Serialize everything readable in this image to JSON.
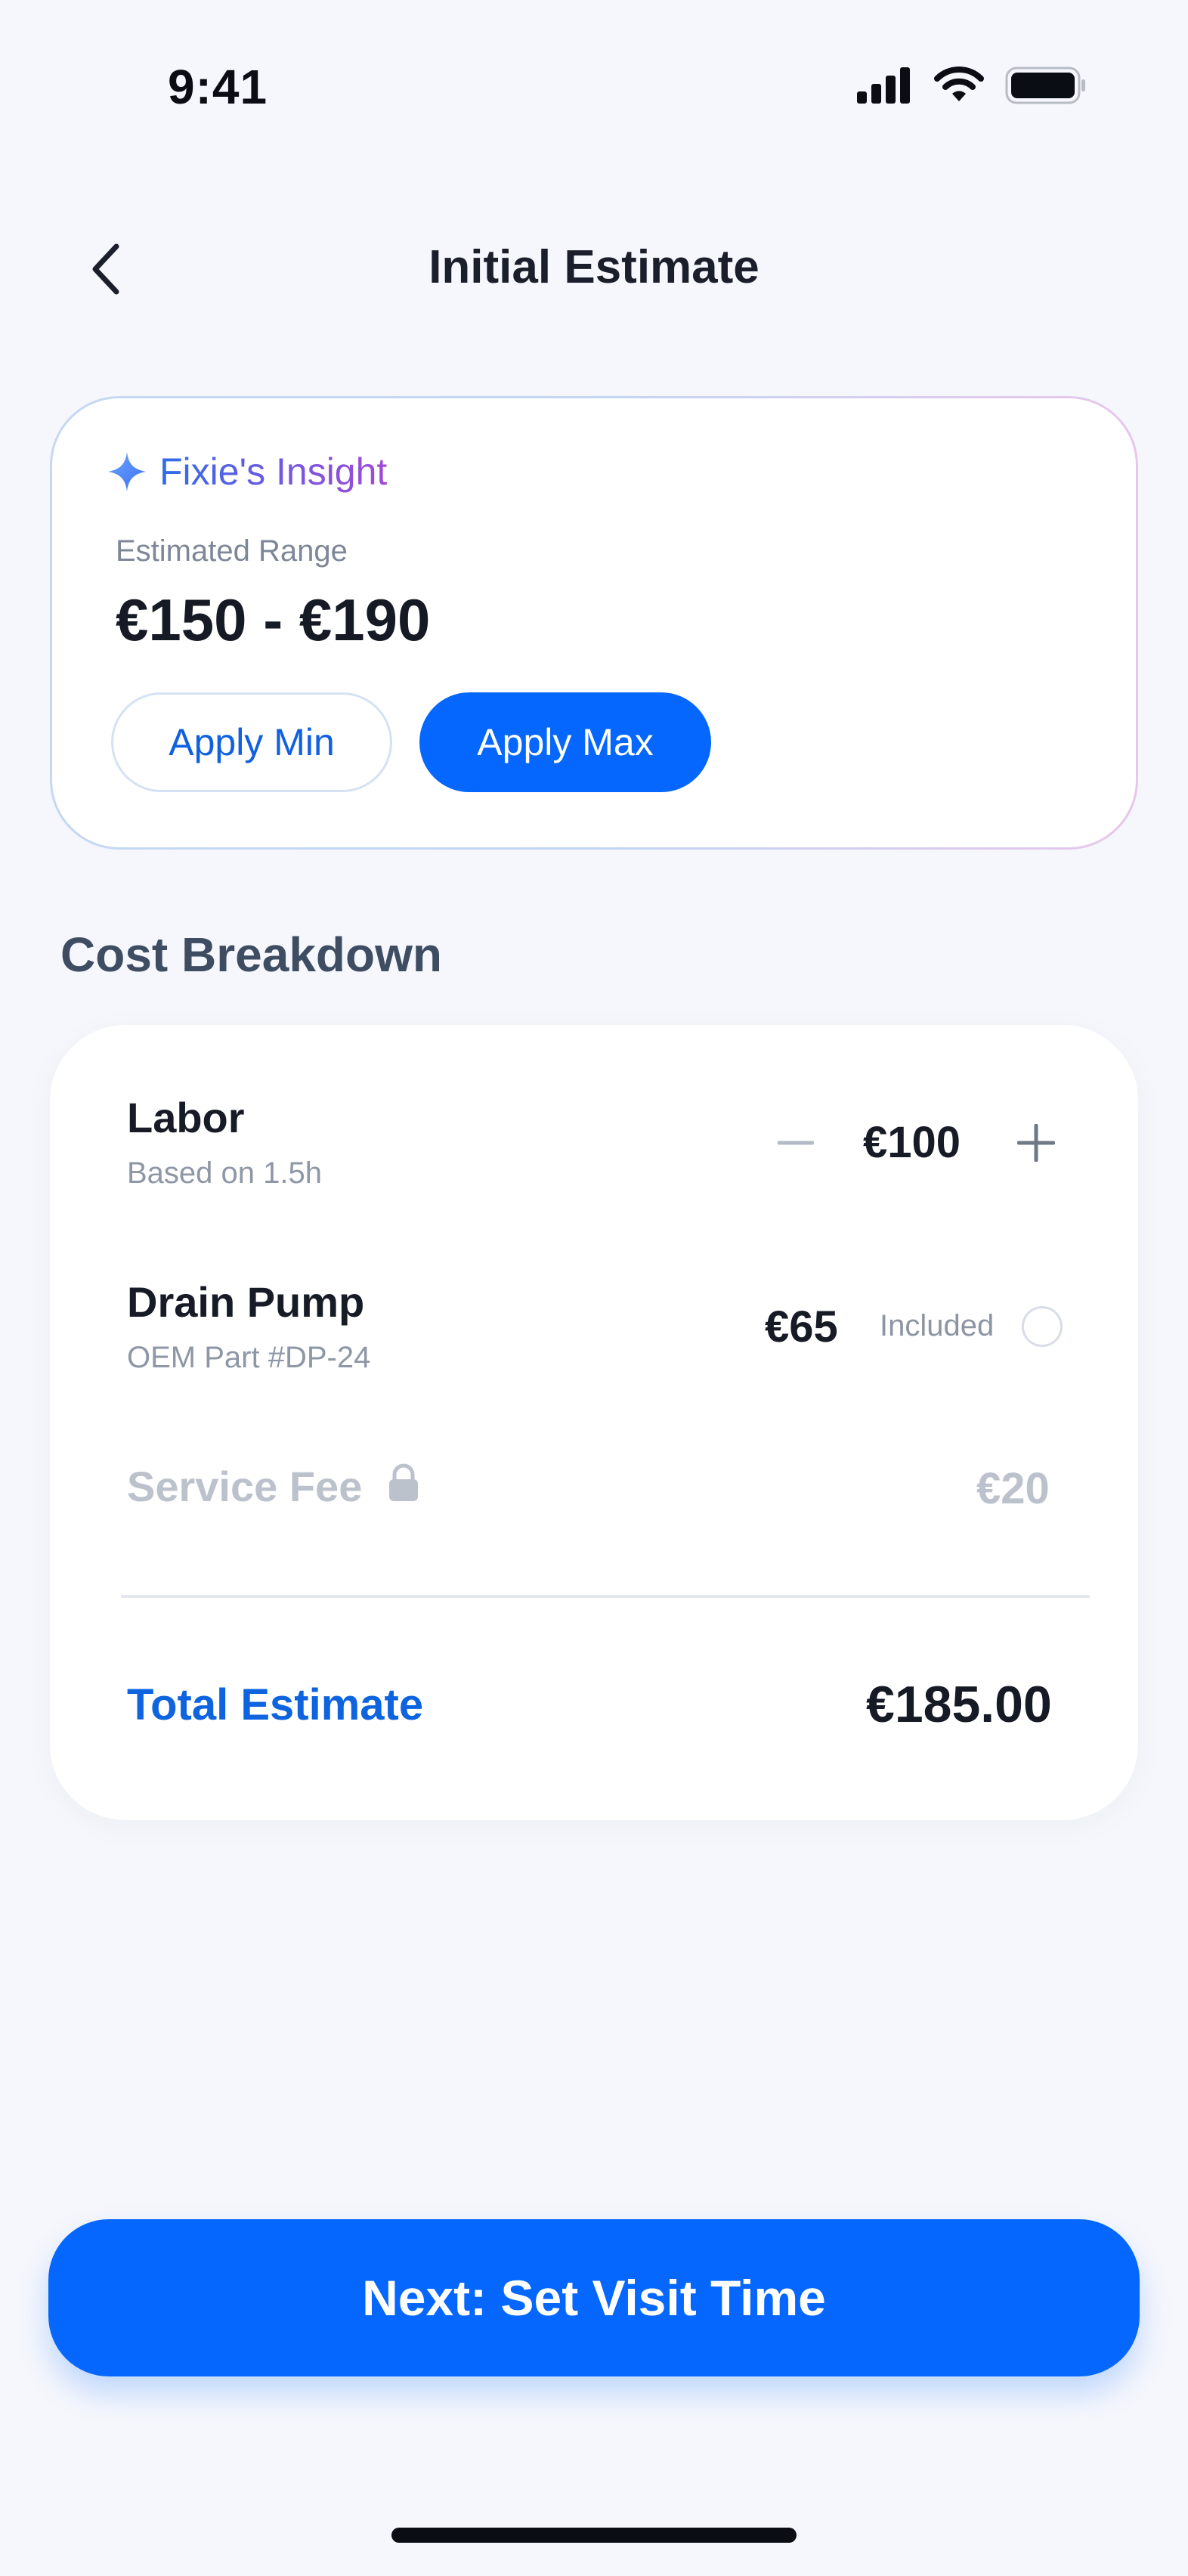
{
  "status_bar": {
    "time": "9:41"
  },
  "header": {
    "title": "Initial Estimate"
  },
  "insight": {
    "title": "Fixie's Insight",
    "range_label": "Estimated Range",
    "range_value": "€150 - €190",
    "apply_min_label": "Apply Min",
    "apply_max_label": "Apply Max"
  },
  "breakdown": {
    "section_title": "Cost Breakdown",
    "labor": {
      "name": "Labor",
      "sub": "Based on 1.5h",
      "amount": "€100"
    },
    "part": {
      "name": "Drain Pump",
      "sub": "OEM Part #DP-24",
      "amount": "€65",
      "included_label": "Included"
    },
    "fee": {
      "name": "Service Fee",
      "amount": "€20"
    },
    "total_label": "Total Estimate",
    "total_value": "€185.00"
  },
  "cta": {
    "label": "Next: Set Visit Time"
  },
  "colors": {
    "accent": "#0567FD",
    "background": "#F5F7FC",
    "total_label": "#0E64DF",
    "disabled_text": "#BCC2CC"
  }
}
